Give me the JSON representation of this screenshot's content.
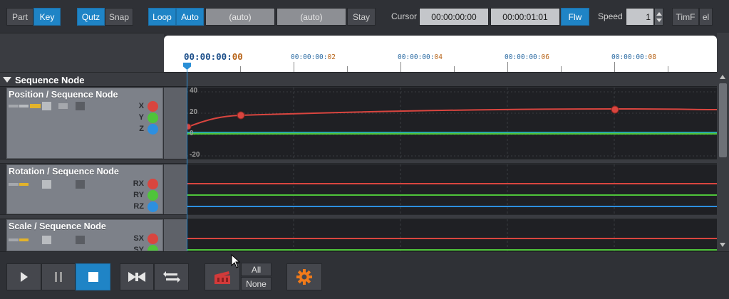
{
  "toolbar": {
    "part": "Part",
    "key": "Key",
    "qutz": "Qutz",
    "snap": "Snap",
    "loop": "Loop",
    "auto": "Auto",
    "range_start": "(auto)",
    "range_end": "(auto)",
    "stay": "Stay",
    "cursor_label": "Cursor",
    "cursor_time": "00:00:00:00",
    "end_time": "00:00:01:01",
    "flw": "Flw",
    "speed_label": "Speed",
    "speed_value": "1",
    "timf": "TimF",
    "el": "el"
  },
  "ruler": {
    "current_main": "00:00:00:",
    "current_frac": "00",
    "labels": [
      {
        "main": "00:00:00:",
        "frac": "02"
      },
      {
        "main": "00:00:00:",
        "frac": "04"
      },
      {
        "main": "00:00:00:",
        "frac": "06"
      },
      {
        "main": "00:00:00:",
        "frac": "08"
      }
    ]
  },
  "sequence": {
    "title": "Sequence Node"
  },
  "tracks": [
    {
      "title": "Position / Sequence Node",
      "axes": [
        "X",
        "Y",
        "Z"
      ],
      "ticks": [
        "40",
        "20",
        "0",
        "-20"
      ]
    },
    {
      "title": "Rotation / Sequence Node",
      "axes": [
        "RX",
        "RY",
        "RZ"
      ]
    },
    {
      "title": "Scale / Sequence Node",
      "axes": [
        "SX",
        "SY"
      ]
    }
  ],
  "transport": {
    "all": "All",
    "none": "None"
  },
  "colors": {
    "accent": "#1f84c6",
    "x_axis": "#d9453f",
    "y_axis": "#4fc43a",
    "z_axis": "#2d8fe0"
  }
}
